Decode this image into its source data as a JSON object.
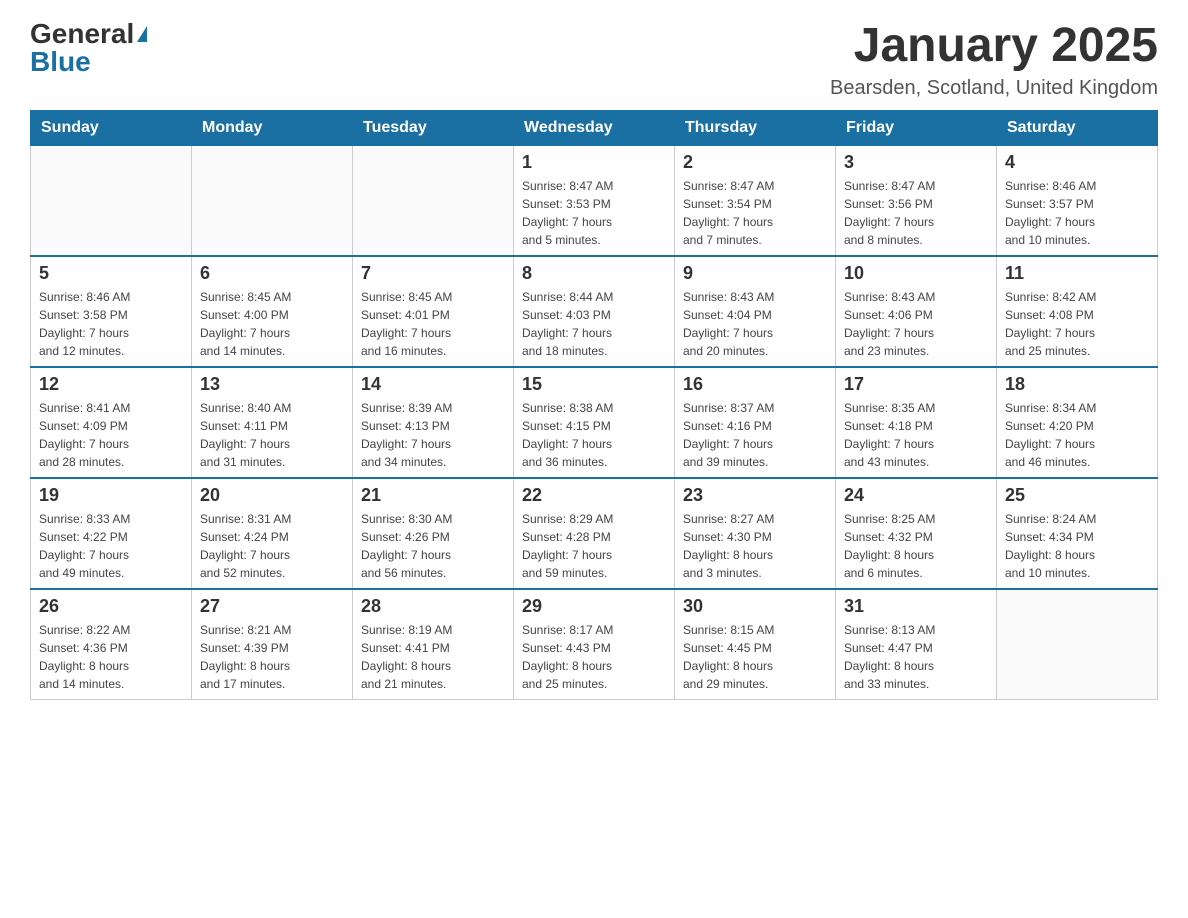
{
  "logo": {
    "general": "General",
    "blue": "Blue"
  },
  "title": "January 2025",
  "subtitle": "Bearsden, Scotland, United Kingdom",
  "weekdays": [
    "Sunday",
    "Monday",
    "Tuesday",
    "Wednesday",
    "Thursday",
    "Friday",
    "Saturday"
  ],
  "weeks": [
    [
      {
        "day": "",
        "info": ""
      },
      {
        "day": "",
        "info": ""
      },
      {
        "day": "",
        "info": ""
      },
      {
        "day": "1",
        "info": "Sunrise: 8:47 AM\nSunset: 3:53 PM\nDaylight: 7 hours\nand 5 minutes."
      },
      {
        "day": "2",
        "info": "Sunrise: 8:47 AM\nSunset: 3:54 PM\nDaylight: 7 hours\nand 7 minutes."
      },
      {
        "day": "3",
        "info": "Sunrise: 8:47 AM\nSunset: 3:56 PM\nDaylight: 7 hours\nand 8 minutes."
      },
      {
        "day": "4",
        "info": "Sunrise: 8:46 AM\nSunset: 3:57 PM\nDaylight: 7 hours\nand 10 minutes."
      }
    ],
    [
      {
        "day": "5",
        "info": "Sunrise: 8:46 AM\nSunset: 3:58 PM\nDaylight: 7 hours\nand 12 minutes."
      },
      {
        "day": "6",
        "info": "Sunrise: 8:45 AM\nSunset: 4:00 PM\nDaylight: 7 hours\nand 14 minutes."
      },
      {
        "day": "7",
        "info": "Sunrise: 8:45 AM\nSunset: 4:01 PM\nDaylight: 7 hours\nand 16 minutes."
      },
      {
        "day": "8",
        "info": "Sunrise: 8:44 AM\nSunset: 4:03 PM\nDaylight: 7 hours\nand 18 minutes."
      },
      {
        "day": "9",
        "info": "Sunrise: 8:43 AM\nSunset: 4:04 PM\nDaylight: 7 hours\nand 20 minutes."
      },
      {
        "day": "10",
        "info": "Sunrise: 8:43 AM\nSunset: 4:06 PM\nDaylight: 7 hours\nand 23 minutes."
      },
      {
        "day": "11",
        "info": "Sunrise: 8:42 AM\nSunset: 4:08 PM\nDaylight: 7 hours\nand 25 minutes."
      }
    ],
    [
      {
        "day": "12",
        "info": "Sunrise: 8:41 AM\nSunset: 4:09 PM\nDaylight: 7 hours\nand 28 minutes."
      },
      {
        "day": "13",
        "info": "Sunrise: 8:40 AM\nSunset: 4:11 PM\nDaylight: 7 hours\nand 31 minutes."
      },
      {
        "day": "14",
        "info": "Sunrise: 8:39 AM\nSunset: 4:13 PM\nDaylight: 7 hours\nand 34 minutes."
      },
      {
        "day": "15",
        "info": "Sunrise: 8:38 AM\nSunset: 4:15 PM\nDaylight: 7 hours\nand 36 minutes."
      },
      {
        "day": "16",
        "info": "Sunrise: 8:37 AM\nSunset: 4:16 PM\nDaylight: 7 hours\nand 39 minutes."
      },
      {
        "day": "17",
        "info": "Sunrise: 8:35 AM\nSunset: 4:18 PM\nDaylight: 7 hours\nand 43 minutes."
      },
      {
        "day": "18",
        "info": "Sunrise: 8:34 AM\nSunset: 4:20 PM\nDaylight: 7 hours\nand 46 minutes."
      }
    ],
    [
      {
        "day": "19",
        "info": "Sunrise: 8:33 AM\nSunset: 4:22 PM\nDaylight: 7 hours\nand 49 minutes."
      },
      {
        "day": "20",
        "info": "Sunrise: 8:31 AM\nSunset: 4:24 PM\nDaylight: 7 hours\nand 52 minutes."
      },
      {
        "day": "21",
        "info": "Sunrise: 8:30 AM\nSunset: 4:26 PM\nDaylight: 7 hours\nand 56 minutes."
      },
      {
        "day": "22",
        "info": "Sunrise: 8:29 AM\nSunset: 4:28 PM\nDaylight: 7 hours\nand 59 minutes."
      },
      {
        "day": "23",
        "info": "Sunrise: 8:27 AM\nSunset: 4:30 PM\nDaylight: 8 hours\nand 3 minutes."
      },
      {
        "day": "24",
        "info": "Sunrise: 8:25 AM\nSunset: 4:32 PM\nDaylight: 8 hours\nand 6 minutes."
      },
      {
        "day": "25",
        "info": "Sunrise: 8:24 AM\nSunset: 4:34 PM\nDaylight: 8 hours\nand 10 minutes."
      }
    ],
    [
      {
        "day": "26",
        "info": "Sunrise: 8:22 AM\nSunset: 4:36 PM\nDaylight: 8 hours\nand 14 minutes."
      },
      {
        "day": "27",
        "info": "Sunrise: 8:21 AM\nSunset: 4:39 PM\nDaylight: 8 hours\nand 17 minutes."
      },
      {
        "day": "28",
        "info": "Sunrise: 8:19 AM\nSunset: 4:41 PM\nDaylight: 8 hours\nand 21 minutes."
      },
      {
        "day": "29",
        "info": "Sunrise: 8:17 AM\nSunset: 4:43 PM\nDaylight: 8 hours\nand 25 minutes."
      },
      {
        "day": "30",
        "info": "Sunrise: 8:15 AM\nSunset: 4:45 PM\nDaylight: 8 hours\nand 29 minutes."
      },
      {
        "day": "31",
        "info": "Sunrise: 8:13 AM\nSunset: 4:47 PM\nDaylight: 8 hours\nand 33 minutes."
      },
      {
        "day": "",
        "info": ""
      }
    ]
  ]
}
